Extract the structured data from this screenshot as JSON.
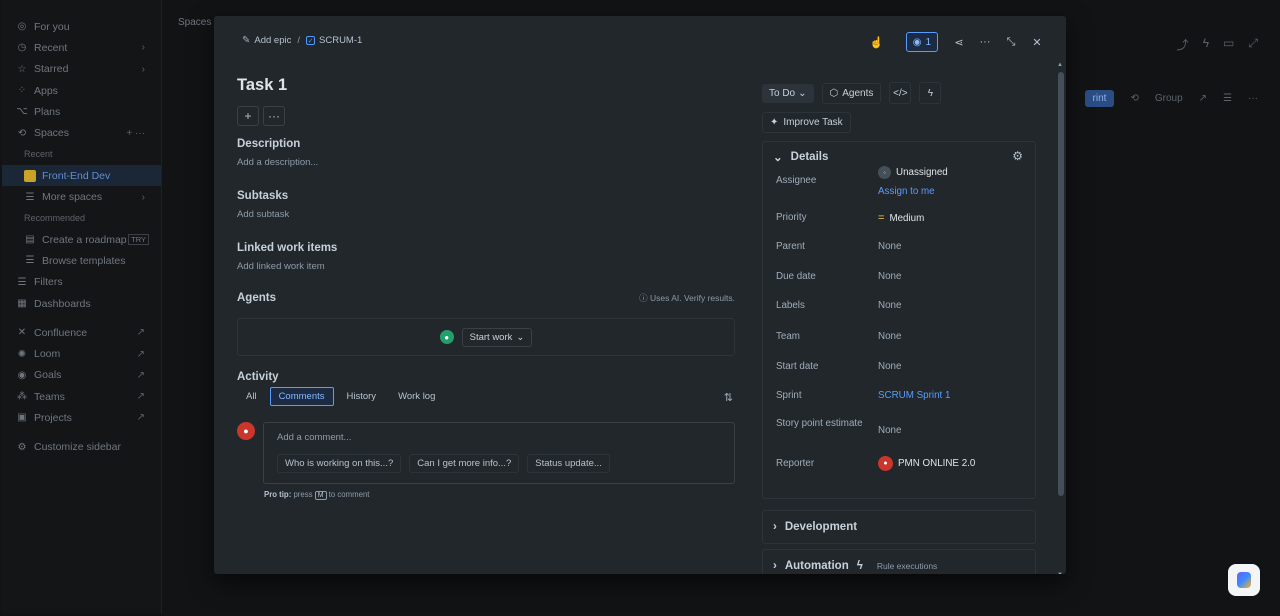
{
  "sidebar": {
    "items": [
      {
        "label": "For you",
        "icon": "user-circle-icon",
        "chev": ""
      },
      {
        "label": "Recent",
        "icon": "clock-icon",
        "chev": "›"
      },
      {
        "label": "Starred",
        "icon": "star-icon",
        "chev": "›"
      },
      {
        "label": "Apps",
        "icon": "apps-icon",
        "chev": ""
      },
      {
        "label": "Plans",
        "icon": "plans-icon",
        "chev": ""
      },
      {
        "label": "Spaces",
        "icon": "spaces-icon",
        "chev": "+  ···"
      }
    ],
    "recent_label": "Recent",
    "active_space": "Front-End Dev",
    "more_spaces": "More spaces",
    "recommended_label": "Recommended",
    "roadmap": "Create a roadmap",
    "roadmap_tag": "TRY",
    "templates": "Browse templates",
    "filters": "Filters",
    "dashboards": "Dashboards",
    "apps": [
      {
        "label": "Confluence",
        "icon": "confluence-icon"
      },
      {
        "label": "Loom",
        "icon": "loom-icon"
      },
      {
        "label": "Goals",
        "icon": "goals-icon"
      },
      {
        "label": "Teams",
        "icon": "teams-icon"
      },
      {
        "label": "Projects",
        "icon": "projects-icon"
      }
    ],
    "customize": "Customize sidebar"
  },
  "bg": {
    "crumb": "Spaces",
    "sprint_btn": "rint",
    "group": "Group"
  },
  "modal": {
    "add_epic": "Add epic",
    "crumb_sep": "/",
    "issue_key": "SCRUM-1",
    "watch_count": "1",
    "title": "Task 1",
    "description_head": "Description",
    "description_ph": "Add a description...",
    "subtasks_head": "Subtasks",
    "subtasks_ph": "Add subtask",
    "linked_head": "Linked work items",
    "linked_ph": "Add linked work item",
    "agents_head": "Agents",
    "ai_note": "Uses AI. Verify results.",
    "start_work": "Start work",
    "activity_head": "Activity",
    "tabs": [
      "All",
      "Comments",
      "History",
      "Work log"
    ],
    "selected_tab": "Comments",
    "comment_ph": "Add a comment...",
    "chips": [
      "Who is working on this...?",
      "Can I get more info...?",
      "Status update..."
    ],
    "protip_label": "Pro tip:",
    "protip_press": "press",
    "protip_key": "M",
    "protip_rest": "to comment"
  },
  "side": {
    "status": "To Do",
    "agents": "Agents",
    "improve": "Improve Task",
    "details_head": "Details",
    "fields": {
      "assignee": "Assignee",
      "assignee_val": "Unassigned",
      "assign_me": "Assign to me",
      "priority": "Priority",
      "priority_val": "Medium",
      "parent": "Parent",
      "parent_val": "None",
      "due": "Due date",
      "due_val": "None",
      "labels": "Labels",
      "labels_val": "None",
      "team": "Team",
      "team_val": "None",
      "start": "Start date",
      "start_val": "None",
      "sprint": "Sprint",
      "sprint_val": "SCRUM Sprint 1",
      "story": "Story point estimate",
      "story_val": "None",
      "reporter": "Reporter",
      "reporter_val": "PMN ONLINE 2.0"
    },
    "development": "Development",
    "automation": "Automation",
    "rule_exec": "Rule executions"
  },
  "colors": {
    "accent": "#579dff",
    "modal_bg": "#22272b",
    "priority_medium": "#f5cd47",
    "avatar_red": "#c9372c"
  }
}
